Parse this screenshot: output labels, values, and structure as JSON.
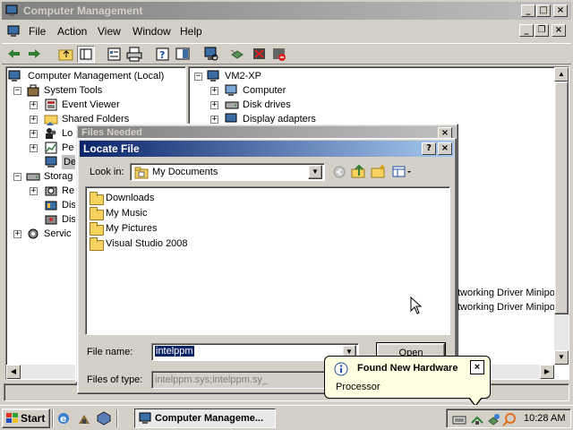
{
  "main_window": {
    "title": "Computer Management",
    "menu": [
      "File",
      "Action",
      "View",
      "Window",
      "Help"
    ]
  },
  "left_tree": [
    {
      "label": "Computer Management (Local)"
    },
    {
      "label": "System Tools"
    },
    {
      "label": "Event Viewer"
    },
    {
      "label": "Shared Folders"
    },
    {
      "label": "Lo"
    },
    {
      "label": "Pe"
    },
    {
      "label": "De"
    },
    {
      "label": "Storag"
    },
    {
      "label": "Re"
    },
    {
      "label": "Dis"
    },
    {
      "label": "Dis"
    },
    {
      "label": "Servic"
    }
  ],
  "right_tree": [
    {
      "label": "VM2-XP"
    },
    {
      "label": "Computer"
    },
    {
      "label": "Disk drives"
    },
    {
      "label": "Display adapters"
    }
  ],
  "right_tail": [
    "tworking Driver Minipor",
    "tworking Driver Miniport"
  ],
  "files_needed": {
    "title": "Files Needed"
  },
  "locate_file": {
    "title": "Locate File",
    "look_in_label": "Look in:",
    "look_in_value": "My Documents",
    "items": [
      "Downloads",
      "My Music",
      "My Pictures",
      "Visual Studio 2008"
    ],
    "file_name_label": "File name:",
    "file_name_value": "intelppm",
    "files_of_type_label": "Files of type:",
    "files_of_type_value": "intelppm.sys;intelppm.sy_",
    "open_button": "Open"
  },
  "balloon": {
    "title": "Found New Hardware",
    "text": "Processor"
  },
  "taskbar": {
    "start": "Start",
    "task": "Computer Manageme...",
    "clock": "10:28 AM"
  }
}
